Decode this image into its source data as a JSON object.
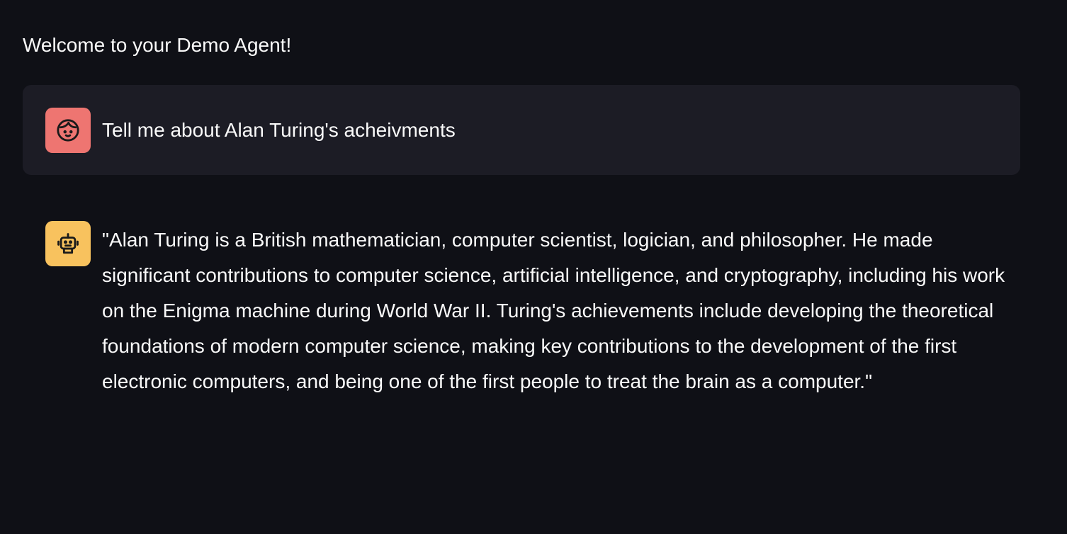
{
  "header": {
    "welcome_text": "Welcome to your Demo Agent!"
  },
  "messages": [
    {
      "role": "user",
      "avatar_icon": "user-face-icon",
      "avatar_color": "#ee7571",
      "text": "Tell me about Alan Turing's acheivments"
    },
    {
      "role": "assistant",
      "avatar_icon": "robot-icon",
      "avatar_color": "#f8c25e",
      "text": "\"Alan Turing is a British mathematician, computer scientist, logician, and philosopher. He made significant contributions to computer science, artificial intelligence, and cryptography, including his work on the Enigma machine during World War II. Turing's achievements include developing the theoretical foundations of modern computer science, making key contributions to the development of the first electronic computers, and being one of the first people to treat the brain as a computer.\""
    }
  ],
  "colors": {
    "background": "#0f1016",
    "user_bubble": "#1c1c25",
    "text": "#fafafa"
  }
}
